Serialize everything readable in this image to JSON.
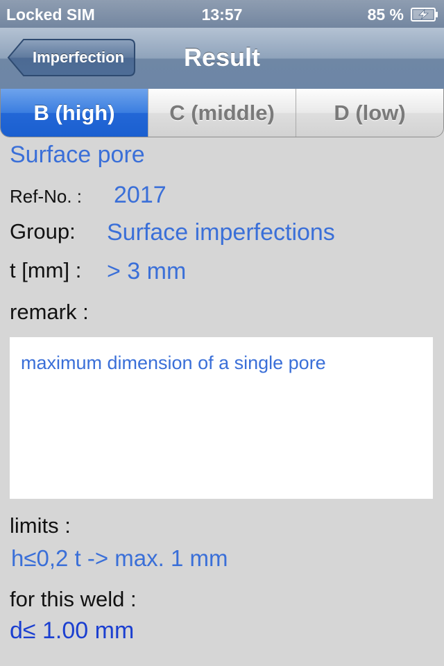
{
  "status_bar": {
    "carrier": "Locked SIM",
    "time": "13:57",
    "battery_percent": "85 %",
    "battery_icon": "battery-charging-icon"
  },
  "nav": {
    "back_label": "Imperfection",
    "title": "Result"
  },
  "segments": [
    {
      "label": "B (high)",
      "selected": true
    },
    {
      "label": "C (middle)",
      "selected": false
    },
    {
      "label": "D (low)",
      "selected": false
    }
  ],
  "detail": {
    "title": "Surface pore",
    "ref_label": "Ref-No. :",
    "ref_value": "2017",
    "group_label": "Group:",
    "group_value": "Surface imperfections",
    "t_label": "t [mm] :",
    "t_value": "> 3 mm",
    "remark_label": "remark :",
    "remark_text": "maximum dimension of a single pore",
    "limits_label": "limits :",
    "limits_value": "h≤0,2 t -> max. 1 mm",
    "weld_label": "for this weld :",
    "weld_value": "d≤ 1.00 mm"
  },
  "colors": {
    "value_blue": "#3a6fd8",
    "weld_blue": "#1b3fd0",
    "active_segment": "#2367d6",
    "background": "#d6d6d6"
  }
}
